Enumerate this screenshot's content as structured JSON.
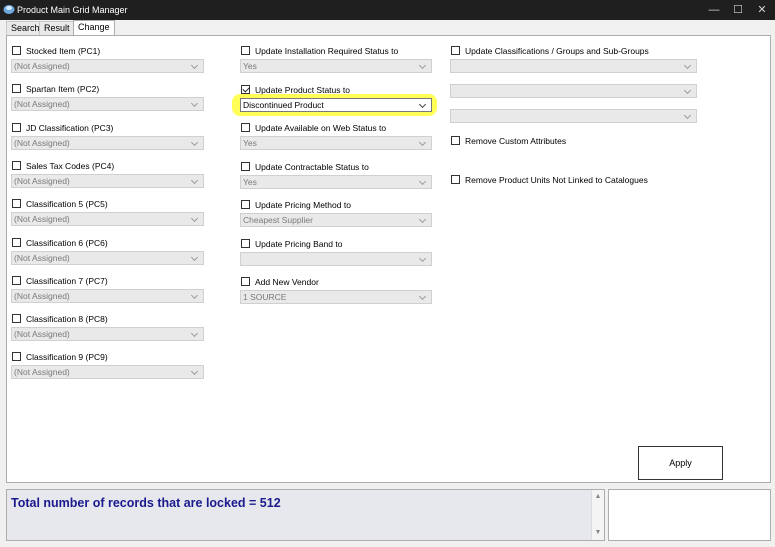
{
  "window": {
    "title": "Product Main Grid Manager",
    "minimize": "—",
    "maximize": "☐",
    "close": "✕"
  },
  "tabs": [
    "Search",
    "Result",
    "Change"
  ],
  "left_column": [
    {
      "label": "Stocked Item (PC1)",
      "value": "(Not Assigned)",
      "checked": false
    },
    {
      "label": "Spartan Item (PC2)",
      "value": "(Not Assigned)",
      "checked": false
    },
    {
      "label": "JD Classification (PC3)",
      "value": "(Not Assigned)",
      "checked": false
    },
    {
      "label": "Sales Tax Codes (PC4)",
      "value": "(Not Assigned)",
      "checked": false
    },
    {
      "label": "Classification 5 (PC5)",
      "value": "(Not Assigned)",
      "checked": false
    },
    {
      "label": "Classification 6 (PC6)",
      "value": "(Not Assigned)",
      "checked": false
    },
    {
      "label": "Classification 7 (PC7)",
      "value": "(Not Assigned)",
      "checked": false
    },
    {
      "label": "Classification 8 (PC8)",
      "value": "(Not Assigned)",
      "checked": false
    },
    {
      "label": "Classification 9 (PC9)",
      "value": "(Not Assigned)",
      "checked": false
    }
  ],
  "middle_column": [
    {
      "label": "Update Installation Required Status to",
      "value": "Yes",
      "checked": false
    },
    {
      "label": "Update Product Status to",
      "value": "Discontinued Product",
      "checked": true
    },
    {
      "label": "Update Available on Web Status to",
      "value": "Yes",
      "checked": false
    },
    {
      "label": "Update Contractable Status to",
      "value": "Yes",
      "checked": false
    },
    {
      "label": "Update Pricing Method to",
      "value": "Cheapest Supplier",
      "checked": false
    },
    {
      "label": "Update Pricing Band to",
      "value": "",
      "checked": false
    },
    {
      "label": "Add New Vendor",
      "value": "1 SOURCE",
      "checked": false
    }
  ],
  "right_column": {
    "classifications_label": "Update Classifications / Groups and Sub-Groups",
    "classification_selects": [
      "",
      "",
      ""
    ],
    "remove_custom_attributes": "Remove Custom Attributes",
    "remove_product_units": "Remove Product Units Not Linked to Catalogues"
  },
  "apply_label": "Apply",
  "status_message": "Total number of records that are locked = 512",
  "colors": {
    "highlight": "#ffff3a",
    "status_text": "#1a1a8c",
    "titlebar": "#1f1f1f"
  }
}
